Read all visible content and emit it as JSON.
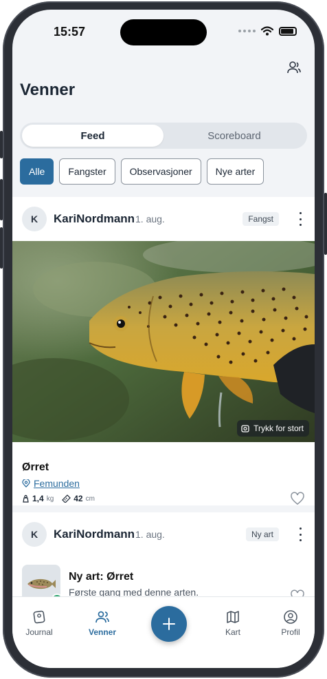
{
  "status_bar": {
    "time": "15:57"
  },
  "header": {
    "title": "Venner"
  },
  "segments": [
    {
      "label": "Feed",
      "active": true
    },
    {
      "label": "Scoreboard",
      "active": false
    }
  ],
  "filters": [
    {
      "label": "Alle",
      "active": true
    },
    {
      "label": "Fangster",
      "active": false
    },
    {
      "label": "Observasjoner",
      "active": false
    },
    {
      "label": "Nye arter",
      "active": false
    }
  ],
  "posts": [
    {
      "avatar_initial": "K",
      "user": "KariNordmann",
      "date": "1. aug.",
      "badge": "Fangst",
      "enlarge_label": "Trykk for stort",
      "species": "Ørret",
      "location": "Femunden",
      "weight_value": "1,4",
      "weight_unit": "kg",
      "length_value": "42",
      "length_unit": "cm"
    },
    {
      "avatar_initial": "K",
      "user": "KariNordmann",
      "date": "1. aug.",
      "badge": "Ny art",
      "title": "Ny art: Ørret",
      "subtitle": "Første gang med denne arten."
    }
  ],
  "tabbar": {
    "journal": "Journal",
    "friends": "Venner",
    "map": "Kart",
    "profile": "Profil"
  },
  "colors": {
    "accent": "#2b6c9e",
    "new_badge": "#27a36a"
  }
}
